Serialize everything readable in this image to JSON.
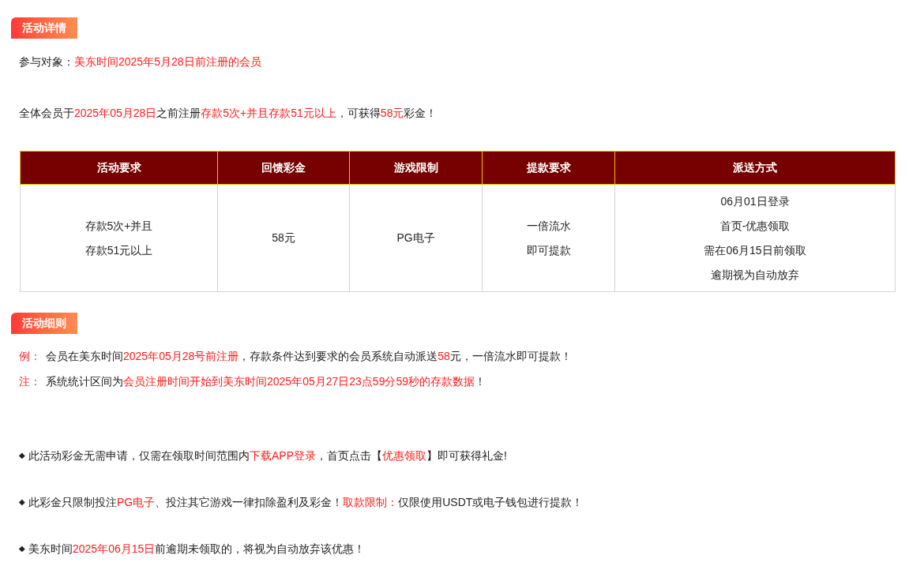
{
  "details_badge": "活动详情",
  "audience": [
    {
      "text": "参与对象：",
      "red": false
    },
    {
      "text": "美东时间2025年5月28日前注册的会员",
      "red": true
    }
  ],
  "summary": [
    {
      "text": "全体会员于",
      "red": false
    },
    {
      "text": "2025年05月28日",
      "red": true
    },
    {
      "text": "之前注册",
      "red": false
    },
    {
      "text": "存款5次+并且存款51元以上",
      "red": true
    },
    {
      "text": "，可获得",
      "red": false
    },
    {
      "text": "58元",
      "red": true
    },
    {
      "text": "彩金！",
      "red": false
    }
  ],
  "table": {
    "columns": [
      "活动要求",
      "回馈彩金",
      "游戏限制",
      "提款要求",
      "派送方式"
    ],
    "rows": [
      [
        [
          "存款5次+并且",
          "存款51元以上"
        ],
        [
          "58元"
        ],
        [
          "PG电子"
        ],
        [
          "一倍流水",
          "即可提款"
        ],
        [
          "06月01日登录",
          "首页-优惠领取",
          "需在06月15日前领取",
          "逾期视为自动放弃"
        ]
      ]
    ]
  },
  "rules_badge": "活动细则",
  "notes": [
    {
      "label": "例：",
      "text": [
        {
          "text": "会员在美东时间",
          "red": false
        },
        {
          "text": "2025年05月28号前注册",
          "red": true
        },
        {
          "text": "，存款条件达到要求的会员系统自动派送",
          "red": false
        },
        {
          "text": "58",
          "red": true
        },
        {
          "text": "元，一倍流水即可提款！",
          "red": false
        }
      ]
    },
    {
      "label": "注：",
      "text": [
        {
          "text": "系统统计区间为",
          "red": false
        },
        {
          "text": "会员注册时间开始到美东时间2025年05月27日23点59分59秒的存款数据",
          "red": true
        },
        {
          "text": "！",
          "red": false
        }
      ]
    }
  ],
  "bullets": [
    {
      "marker": "◆",
      "text": [
        {
          "text": "此活动彩金无需申请，仅需在领取时间范围内",
          "red": false
        },
        {
          "text": "下载APP登录",
          "red": true
        },
        {
          "text": "，首页点击【",
          "red": false
        },
        {
          "text": "优惠领取",
          "red": true
        },
        {
          "text": "】即可获得礼金!",
          "red": false
        }
      ]
    },
    {
      "marker": "◆",
      "text": [
        {
          "text": "此彩金只限制投注",
          "red": false
        },
        {
          "text": "PG电子",
          "red": true
        },
        {
          "text": "、投注其它游戏一律扣除盈利及彩金！",
          "red": false
        },
        {
          "text": "取款限制：",
          "red": true
        },
        {
          "text": "仅限使用USDT或电子钱包进行提款！",
          "red": false
        }
      ]
    },
    {
      "marker": "◆",
      "text": [
        {
          "text": "美东时间",
          "red": false
        },
        {
          "text": "2025年06月15日",
          "red": true
        },
        {
          "text": "前逾期未领取的，将视为自动放弃该优惠！",
          "red": false
        }
      ]
    }
  ]
}
